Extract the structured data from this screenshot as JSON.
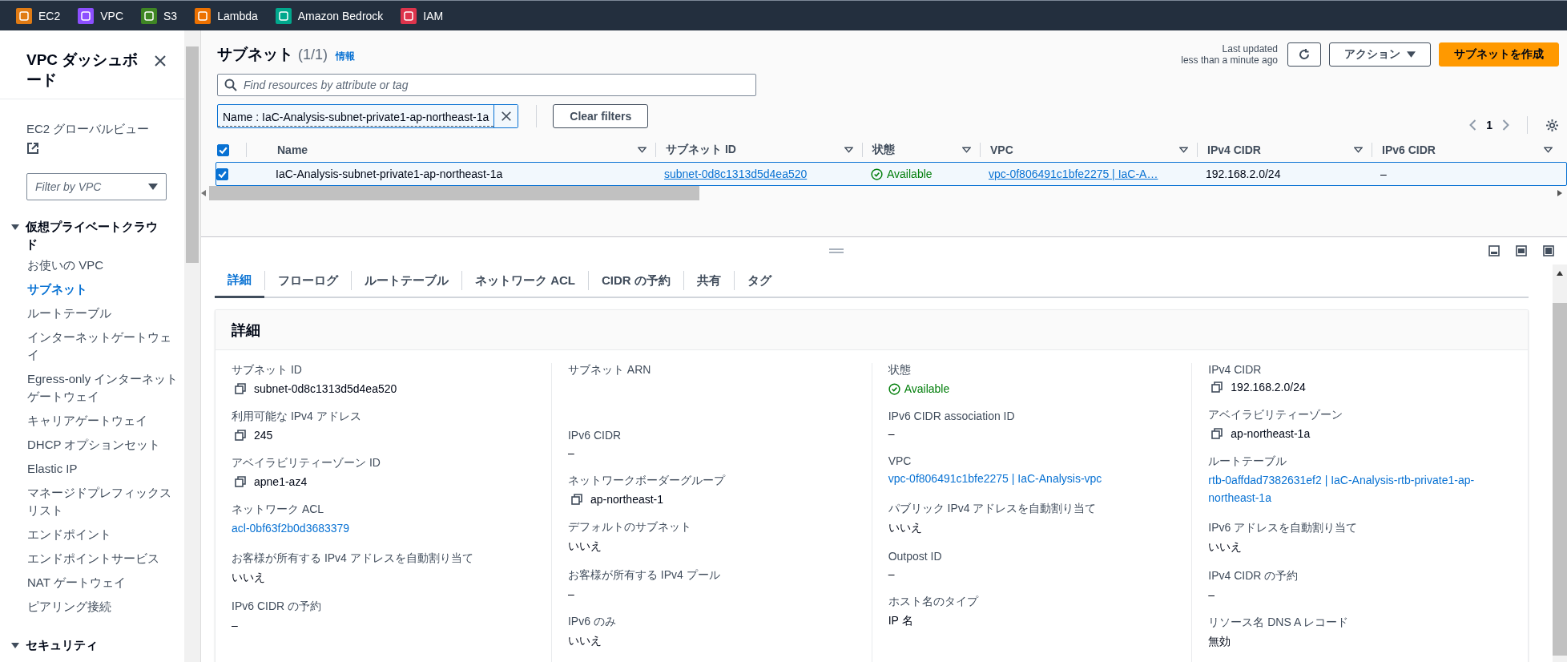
{
  "top_nav": {
    "services": [
      {
        "label": "EC2",
        "color": "#e07b14"
      },
      {
        "label": "VPC",
        "color": "#8c4fff"
      },
      {
        "label": "S3",
        "color": "#3f8624"
      },
      {
        "label": "Lambda",
        "color": "#ed7100"
      },
      {
        "label": "Amazon Bedrock",
        "color": "#01a88d"
      },
      {
        "label": "IAM",
        "color": "#dd344c"
      }
    ]
  },
  "sidebar": {
    "title": "VPC ダッシュボード",
    "global_view": "EC2 グローバルビュー",
    "filter_placeholder": "Filter by VPC",
    "sections": [
      {
        "label": "仮想プライベートクラウド",
        "expanded": true,
        "children": [
          {
            "label": "お使いの VPC",
            "selected": false
          },
          {
            "label": "サブネット",
            "selected": true
          },
          {
            "label": "ルートテーブル",
            "selected": false
          },
          {
            "label": "インターネットゲートウェイ",
            "selected": false
          },
          {
            "label": "Egress-only インターネットゲートウェイ",
            "selected": false
          },
          {
            "label": "キャリアゲートウェイ",
            "selected": false
          },
          {
            "label": "DHCP オプションセット",
            "selected": false
          },
          {
            "label": "Elastic IP",
            "selected": false
          },
          {
            "label": "マネージドプレフィックスリスト",
            "selected": false
          },
          {
            "label": "エンドポイント",
            "selected": false
          },
          {
            "label": "エンドポイントサービス",
            "selected": false
          },
          {
            "label": "NAT ゲートウェイ",
            "selected": false
          },
          {
            "label": "ピアリング接続",
            "selected": false
          }
        ]
      },
      {
        "label": "セキュリティ",
        "expanded": true
      }
    ]
  },
  "header": {
    "title": "サブネット",
    "count": "(1/1)",
    "info": "情報",
    "last_updated": "Last updated",
    "updated_ago": "less than a minute ago",
    "actions": "アクション",
    "create": "サブネットを作成"
  },
  "search": {
    "placeholder": "Find resources by attribute or tag"
  },
  "filter_token": "Name : IaC-Analysis-subnet-private1-ap-northeast-1a",
  "clear_filters": "Clear filters",
  "pagination": {
    "page": "1"
  },
  "table": {
    "all_checked": true,
    "columns": [
      "Name",
      "サブネット ID",
      "状態",
      "VPC",
      "IPv4 CIDR",
      "IPv6 CIDR"
    ],
    "rows": [
      {
        "selected": true,
        "cells": [
          {
            "kind": "text",
            "text": "IaC-Analysis-subnet-private1-ap-northeast-1a"
          },
          {
            "kind": "link",
            "text": "subnet-0d8c1313d5d4ea520"
          },
          {
            "kind": "status",
            "text": "Available"
          },
          {
            "kind": "link",
            "text": "vpc-0f806491c1bfe2275 | IaC-A…"
          },
          {
            "kind": "text",
            "text": "192.168.2.0/24"
          },
          {
            "kind": "text",
            "text": "–"
          }
        ]
      }
    ]
  },
  "tabs": [
    {
      "label": "詳細",
      "selected": true
    },
    {
      "label": "フローログ",
      "selected": false
    },
    {
      "label": "ルートテーブル",
      "selected": false
    },
    {
      "label": "ネットワーク ACL",
      "selected": false
    },
    {
      "label": "CIDR の予約",
      "selected": false
    },
    {
      "label": "共有",
      "selected": false
    },
    {
      "label": "タグ",
      "selected": false
    }
  ],
  "details": {
    "title": "詳細",
    "columns": [
      [
        {
          "label": "サブネット ID",
          "kind": "copy",
          "value": "subnet-0d8c1313d5d4ea520"
        },
        {
          "label": "利用可能な IPv4 アドレス",
          "kind": "copy",
          "value": "245"
        },
        {
          "label": "アベイラビリティーゾーン ID",
          "kind": "copy",
          "value": "apne1-az4"
        },
        {
          "label": "ネットワーク ACL",
          "kind": "link",
          "value": "acl-0bf63f2b0d3683379"
        },
        {
          "label": "お客様が所有する IPv4 アドレスを自動割り当て",
          "kind": "text",
          "value": "いいえ"
        },
        {
          "label": "IPv6 CIDR の予約",
          "kind": "text",
          "value": "–"
        }
      ],
      [
        {
          "label": "サブネット ARN",
          "kind": "blank"
        },
        {
          "label": "IPv6 CIDR",
          "kind": "text",
          "value": "–"
        },
        {
          "label": "ネットワークボーダーグループ",
          "kind": "copy",
          "value": "ap-northeast-1"
        },
        {
          "label": "デフォルトのサブネット",
          "kind": "text",
          "value": "いいえ"
        },
        {
          "label": "お客様が所有する IPv4 プール",
          "kind": "text",
          "value": "–"
        },
        {
          "label": "IPv6 のみ",
          "kind": "text",
          "value": "いいえ"
        }
      ],
      [
        {
          "label": "状態",
          "kind": "status",
          "value": "Available"
        },
        {
          "label": "IPv6 CIDR association ID",
          "kind": "text",
          "value": "–"
        },
        {
          "label": "VPC",
          "kind": "link",
          "value": "vpc-0f806491c1bfe2275 | IaC-Analysis-vpc"
        },
        {
          "label": "パブリック IPv4 アドレスを自動割り当て",
          "kind": "text",
          "value": "いいえ"
        },
        {
          "label": "Outpost ID",
          "kind": "text",
          "value": "–"
        },
        {
          "label": "ホスト名のタイプ",
          "kind": "text",
          "value": "IP 名"
        }
      ],
      [
        {
          "label": "IPv4 CIDR",
          "kind": "copy",
          "value": "192.168.2.0/24"
        },
        {
          "label": "アベイラビリティーゾーン",
          "kind": "copy",
          "value": "ap-northeast-1a"
        },
        {
          "label": "ルートテーブル",
          "kind": "link",
          "value": "rtb-0affdad7382631ef2 | IaC-Analysis-rtb-private1-ap-northeast-1a"
        },
        {
          "label": "IPv6 アドレスを自動割り当て",
          "kind": "text",
          "value": "いいえ"
        },
        {
          "label": "IPv4 CIDR の予約",
          "kind": "text",
          "value": "–"
        },
        {
          "label": "リソース名 DNS A レコード",
          "kind": "text",
          "value": "無効"
        }
      ]
    ]
  }
}
